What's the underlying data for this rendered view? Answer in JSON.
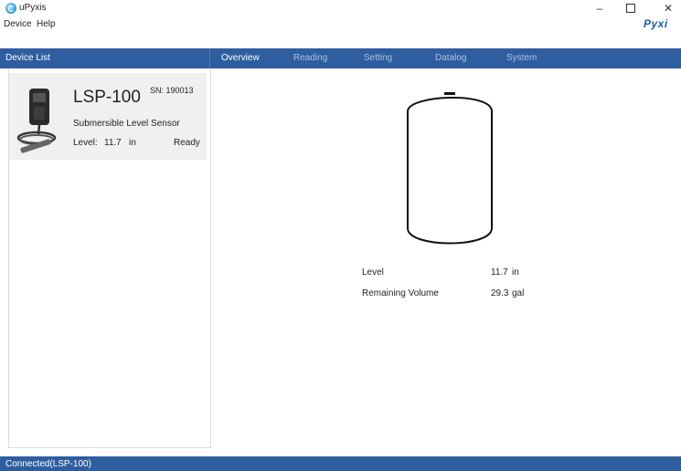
{
  "window": {
    "title": "uPyxis",
    "minimize_glyph": "–",
    "close_glyph": "✕"
  },
  "menu": {
    "items": [
      "Device",
      "Help"
    ],
    "brand": "Pyxi"
  },
  "device_list": {
    "header": "Device List",
    "device": {
      "model": "LSP-100",
      "sn_label": "SN: 190013",
      "description": "Submersible Level Sensor",
      "level_label": "Level:",
      "level_value": "11.7",
      "level_unit": "in",
      "status": "Ready"
    }
  },
  "tabs": [
    {
      "label": "Overview",
      "active": true
    },
    {
      "label": "Reading",
      "active": false
    },
    {
      "label": "Setting",
      "active": false
    },
    {
      "label": "Datalog",
      "active": false
    },
    {
      "label": "System",
      "active": false
    }
  ],
  "overview": {
    "level_label": "Level",
    "level_value": "11.7",
    "level_unit": "in",
    "volume_label": "Remaining Volume",
    "volume_value": "29.3",
    "volume_unit": "gal"
  },
  "status_bar": {
    "text": "Connected(LSP-100)"
  },
  "colors": {
    "accent_bar": "#2f5ea0",
    "card_bg": "#f0f0f0",
    "tab_inactive": "#aac0de",
    "brand": "#1f5fa8"
  },
  "icons": {
    "app": "upyxis-app-icon",
    "device": "lsp-100-sensor-image"
  }
}
